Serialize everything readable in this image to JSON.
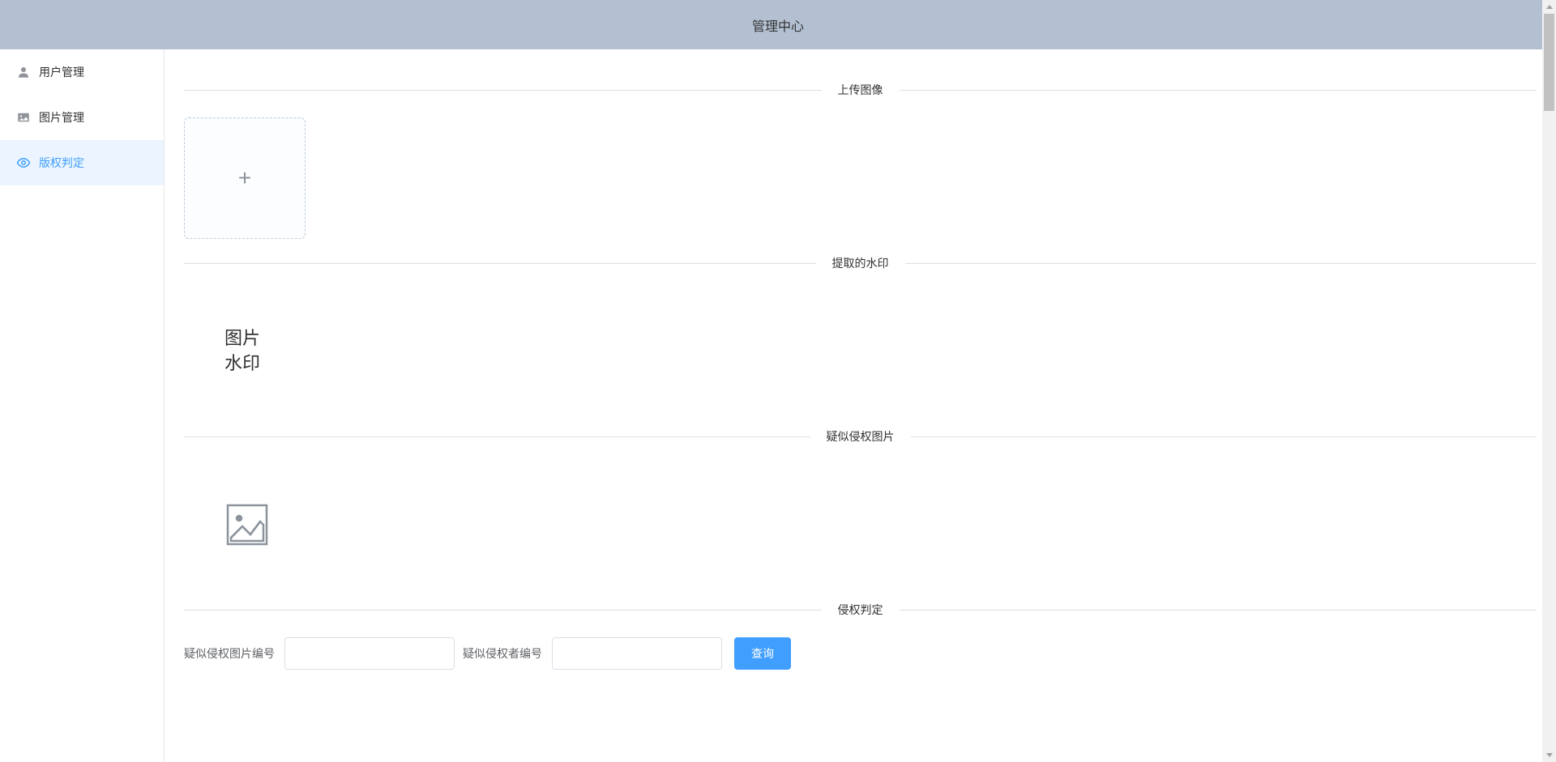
{
  "header": {
    "title": "管理中心"
  },
  "sidebar": {
    "items": [
      {
        "label": "用户管理",
        "icon": "user-icon",
        "active": false
      },
      {
        "label": "图片管理",
        "icon": "image-icon",
        "active": false
      },
      {
        "label": "版权判定",
        "icon": "eye-icon",
        "active": true
      }
    ]
  },
  "sections": {
    "upload": {
      "title": "上传图像"
    },
    "watermark": {
      "title": "提取的水印",
      "text_line1": "图片",
      "text_line2": "水印"
    },
    "suspected": {
      "title": "疑似侵权图片"
    },
    "judgment": {
      "title": "侵权判定",
      "image_id_label": "疑似侵权图片编号",
      "image_id_value": "",
      "user_id_label": "疑似侵权者编号",
      "user_id_value": "",
      "query_button": "查询"
    }
  }
}
